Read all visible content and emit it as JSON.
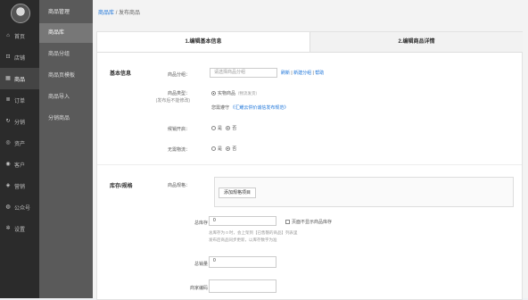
{
  "sidebar": {
    "items": [
      {
        "label": "首页",
        "icon": "home-icon",
        "glyph": "⌂"
      },
      {
        "label": "店铺",
        "icon": "cart-icon",
        "glyph": "⊡"
      },
      {
        "label": "商品",
        "icon": "grid-icon",
        "glyph": "▦"
      },
      {
        "label": "订单",
        "icon": "list-icon",
        "glyph": "≣"
      },
      {
        "label": "分销",
        "icon": "share-icon",
        "glyph": "↻"
      },
      {
        "label": "资产",
        "icon": "coin-icon",
        "glyph": "◎"
      },
      {
        "label": "客户",
        "icon": "user-icon",
        "glyph": "◉"
      },
      {
        "label": "营销",
        "icon": "megaphone-icon",
        "glyph": "◈"
      },
      {
        "label": "公众号",
        "icon": "wechat-icon",
        "glyph": "◍"
      },
      {
        "label": "设置",
        "icon": "gear-icon",
        "glyph": "✲"
      }
    ],
    "active_index": 2
  },
  "subnav": {
    "header": "商品管理",
    "items": [
      "商品库",
      "商品分组",
      "商品页模板",
      "商品导入",
      "分销商品"
    ],
    "active_index": 0
  },
  "breadcrumb": {
    "root": "商品库",
    "sep": "/",
    "current": "发布商品"
  },
  "tabs": [
    "1.编辑基本信息",
    "2.编辑商品详情"
  ],
  "basic": {
    "title": "基本信息",
    "group_label": "商品分组：",
    "group_placeholder": "请选择商品分组",
    "refresh": "刷新",
    "new_group": "新建分组",
    "help": "帮助",
    "type_label": "商品类型：",
    "type_hint": "(发布后不能修改)",
    "type_option": "实物商品",
    "type_option_note": "（物流发货）",
    "promise_prefix": "您需遵守",
    "promise_link": "《汇耀云供价诚信发布规范》",
    "presale_label": "候销开启：",
    "nocustom_label": "无需物流：",
    "yes": "是",
    "no": "否"
  },
  "stock": {
    "title": "库存/规格",
    "spec_label": "商品规格：",
    "add_spec": "添加规格项目",
    "total_label": "总库存：",
    "total_value": "0",
    "hide_stock": "页面不显示商品库存",
    "note1": "总库存为 0 时，会上架到【已售罄的商品】列表里",
    "note2": "发布后商品同步更新，以库存数字为准",
    "sales_label": "总销量：",
    "sales_value": "0",
    "code_label": "商家编码："
  }
}
